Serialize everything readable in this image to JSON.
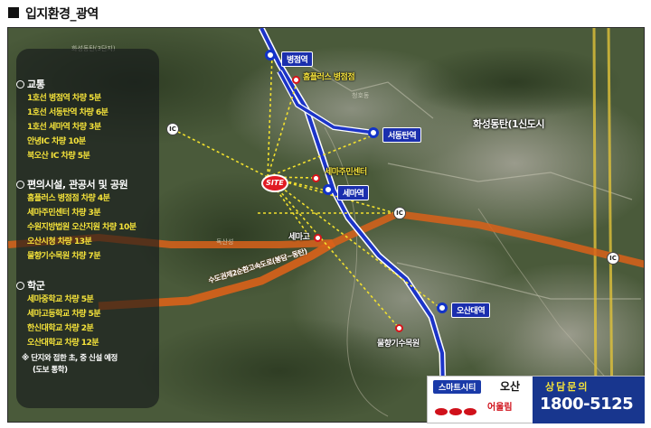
{
  "header": {
    "title": "입지환경_광역"
  },
  "panel": {
    "sections": [
      {
        "title": "교통",
        "items": [
          "1호선 병점역 차량 5분",
          "1호선 서동탄역 차량 6분",
          "1호선 세마역 차량 3분",
          "안녕IC 차량 10분",
          "북오산 IC 차량 5분"
        ]
      },
      {
        "title": "편의시설, 관공서 및 공원",
        "items": [
          "홈플러스 병점점 차량 4분",
          "세마주민센터 차량 3분",
          "수원지방법원 오산지원 차량 10분",
          "오산시청 차량 13분",
          "물향기수목원 차량 7분"
        ]
      },
      {
        "title": "학군",
        "items": [
          "세마중학교 차량 5분",
          "세마고등학교 차량 5분",
          "한신대학교 차량 2분",
          "오산대학교 차량 12분"
        ]
      }
    ],
    "note_line1": "※ 단지와 접한 초, 중 신설 예정",
    "note_line2": "(도보 통학)"
  },
  "map": {
    "stations": [
      "병점역",
      "서동탄역",
      "세마역",
      "오산대역"
    ],
    "pois": [
      "홈플러스 병점점",
      "세마주민센터",
      "세마고",
      "물향기수목원"
    ],
    "region": "화성동탄(1신도시",
    "site_badge": "SITE",
    "ic_label": "IC",
    "highway": "수도권제2순환고속도로(봉담~동탄)",
    "faint_labels": [
      "화성동탄(3단지)",
      "청호동",
      "독산성"
    ]
  },
  "contact": {
    "tag": "스마트시티",
    "city": "오산",
    "brand": "어울림",
    "cta": "상담문의",
    "phone": "1800-5125"
  }
}
